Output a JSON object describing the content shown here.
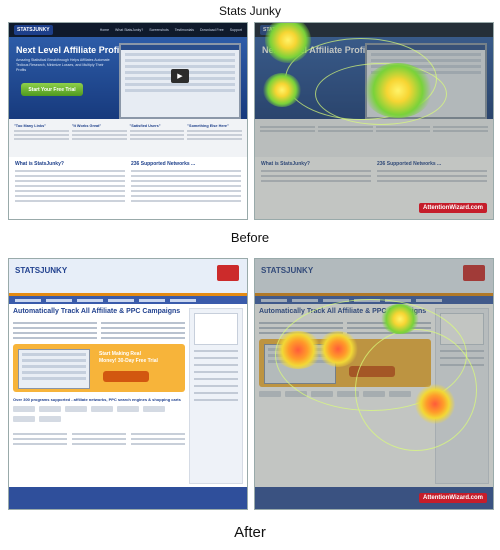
{
  "title": "Stats Junky",
  "captions": {
    "before": "Before",
    "after": "After"
  },
  "before_page": {
    "logo": "STATSJUNKY",
    "nav": [
      "Home",
      "What StatsJunky?",
      "Screenshots",
      "Testimonials",
      "Download Free",
      "Support"
    ],
    "headline": "Next Level Affiliate Profits",
    "subtext": "Amazing Statistical Breakthrough Helps Affiliates Automate Tedious Research, Minimize Losses, and Multiply Their Profits",
    "cta": "Start Your Free Trial",
    "columns": [
      "\"Too Many Links\"",
      "\"It Works Great\"",
      "\"Satisfied Users\"",
      "\"Something Else Here\""
    ],
    "lower_left_title": "What is StatsJunky?",
    "lower_right_title": "236 Supported Networks ..."
  },
  "after_page": {
    "logo": "STATSJUNKY",
    "headline": "Automatically Track All Affiliate & PPC Campaigns",
    "start_text": "Start Making Real Money! 30-Day Free Trial",
    "logos_title": "Over 300 programs supported - affiliate networks, PPC search engines & shopping carts"
  },
  "overlay_brand": "AttentionWizard.com"
}
